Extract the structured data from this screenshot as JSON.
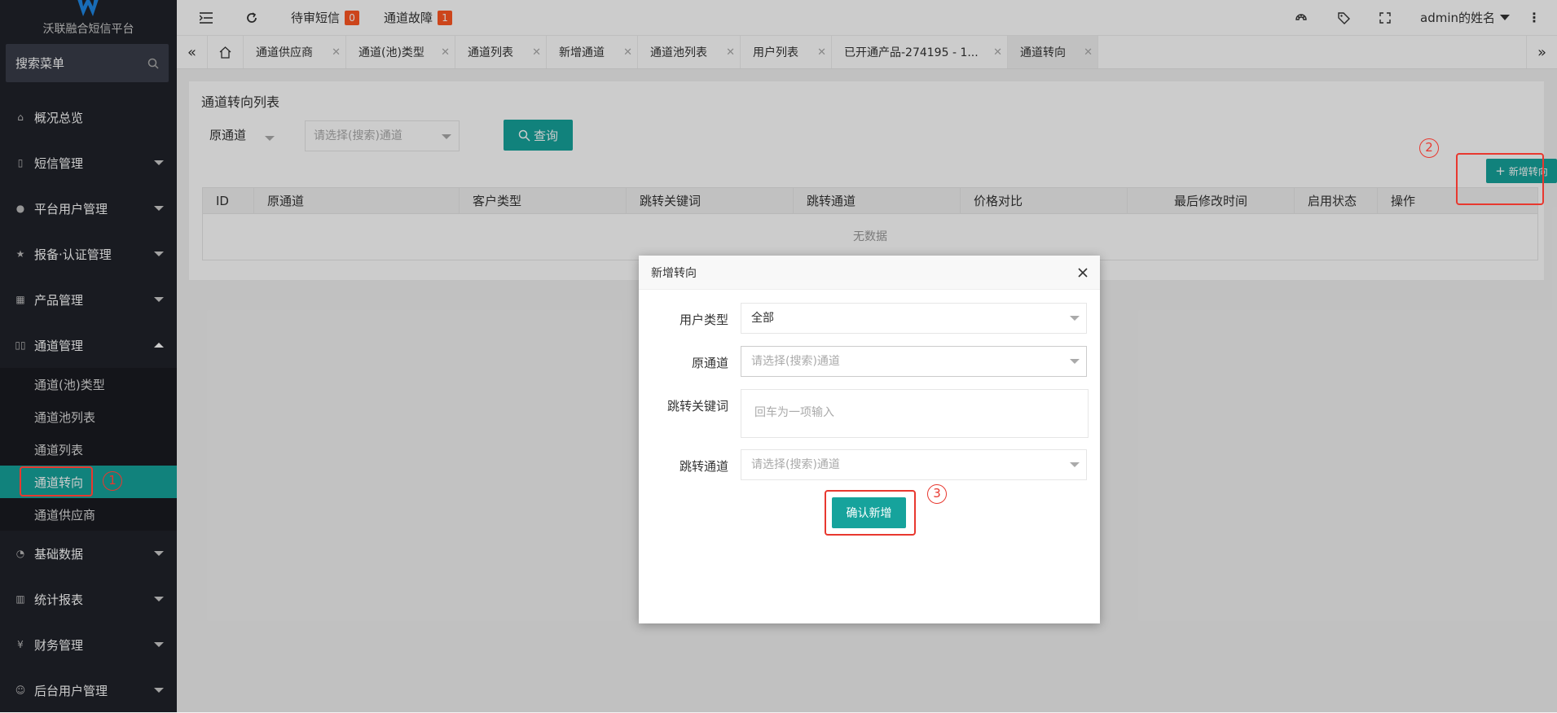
{
  "app": {
    "logo_text": "沃联融合短信平台"
  },
  "sidebar": {
    "search_label": "搜索菜单",
    "items": [
      {
        "label": "概况总览",
        "icon": "home-icon"
      },
      {
        "label": "短信管理",
        "icon": "phone-icon"
      },
      {
        "label": "平台用户管理",
        "icon": "users-icon"
      },
      {
        "label": "报备·认证管理",
        "icon": "star-icon"
      },
      {
        "label": "产品管理",
        "icon": "product-icon"
      },
      {
        "label": "通道管理",
        "icon": "channel-icon"
      },
      {
        "label": "基础数据",
        "icon": "data-icon"
      },
      {
        "label": "统计报表",
        "icon": "chart-icon"
      },
      {
        "label": "财务管理",
        "icon": "yen-icon"
      },
      {
        "label": "后台用户管理",
        "icon": "user-icon"
      }
    ],
    "sub_items": [
      "通道(池)类型",
      "通道池列表",
      "通道列表",
      "通道转向",
      "通道供应商"
    ]
  },
  "topbar": {
    "pending_sms_label": "待审短信",
    "pending_sms_count": "0",
    "channel_fault_label": "通道故障",
    "channel_fault_count": "1",
    "user_name": "admin的姓名"
  },
  "tabs": [
    {
      "label": "通道供应商"
    },
    {
      "label": "通道(池)类型"
    },
    {
      "label": "通道列表"
    },
    {
      "label": "新增通道"
    },
    {
      "label": "通道池列表"
    },
    {
      "label": "用户列表"
    },
    {
      "label": "已开通产品-274195 - 1..."
    },
    {
      "label": "通道转向"
    }
  ],
  "page": {
    "title": "通道转向列表",
    "filter_label": "原通道",
    "filter_placeholder": "请选择(搜索)通道",
    "query_button": "查询",
    "add_button": "新增转向",
    "columns": [
      "ID",
      "原通道",
      "客户类型",
      "跳转关键词",
      "跳转通道",
      "价格对比",
      "最后修改时间",
      "启用状态",
      "操作"
    ],
    "empty_text": "无数据"
  },
  "modal": {
    "title": "新增转向",
    "user_type_label": "用户类型",
    "user_type_value": "全部",
    "source_channel_label": "原通道",
    "source_channel_placeholder": "请选择(搜索)通道",
    "keyword_label": "跳转关键词",
    "keyword_placeholder": "回车为一项输入",
    "target_channel_label": "跳转通道",
    "target_channel_placeholder": "请选择(搜索)通道",
    "confirm_button": "确认新增"
  },
  "annotations": {
    "step1": "1",
    "step2": "2",
    "step3": "3",
    "color": "#e8382f"
  },
  "colors": {
    "accent": "#16a39c",
    "sidebar": "#20222a",
    "badge": "#ff5722"
  }
}
